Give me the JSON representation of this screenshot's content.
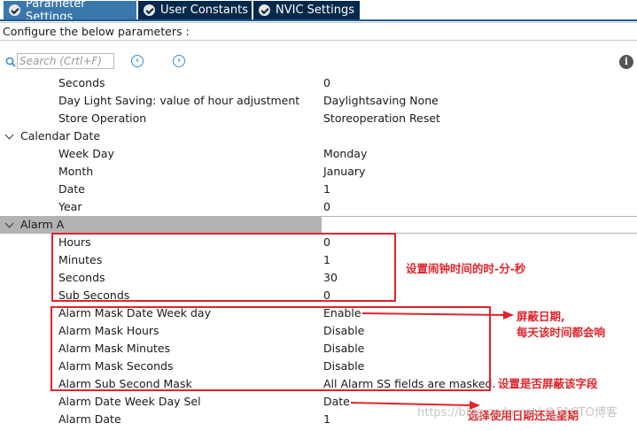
{
  "tabs": [
    {
      "label": "Parameter Settings",
      "active": true
    },
    {
      "label": "User Constants",
      "active": false
    },
    {
      "label": "NVIC Settings",
      "active": false
    }
  ],
  "configure_label": "Configure the below parameters :",
  "search": {
    "placeholder": "Search (Crtl+F)"
  },
  "rows": [
    {
      "name": "Seconds",
      "value": "0"
    },
    {
      "name": "Day Light Saving: value of hour adjustment",
      "value": "Daylightsaving None"
    },
    {
      "name": "Store Operation",
      "value": "Storeoperation Reset"
    },
    {
      "group": "Calendar Date"
    },
    {
      "name": "Week Day",
      "value": "Monday"
    },
    {
      "name": "Month",
      "value": "January"
    },
    {
      "name": "Date",
      "value": "1"
    },
    {
      "name": "Year",
      "value": "0"
    },
    {
      "group": "Alarm A"
    },
    {
      "name": "Hours",
      "value": "0"
    },
    {
      "name": "Minutes",
      "value": "1"
    },
    {
      "name": "Seconds",
      "value": "30"
    },
    {
      "name": "Sub Seconds",
      "value": "0"
    },
    {
      "name": "Alarm Mask Date Week day",
      "value": "Enable"
    },
    {
      "name": "Alarm Mask Hours",
      "value": "Disable"
    },
    {
      "name": "Alarm Mask Minutes",
      "value": "Disable"
    },
    {
      "name": "Alarm Mask Seconds",
      "value": "Disable"
    },
    {
      "name": "Alarm Sub Second Mask",
      "value": "All Alarm SS fields are masked."
    },
    {
      "name": "Alarm Date Week Day Sel",
      "value": "Date"
    },
    {
      "name": "Alarm Date",
      "value": "1"
    }
  ],
  "annotations": {
    "time": "设置闹钟时间的时-分-秒",
    "mask_line1": "屏蔽日期,",
    "mask_line2": "每天该时间都会响",
    "mask_field": "设置是否屏蔽该字段",
    "date_sel": "选择使用日期还是星期"
  },
  "watermark": "https://blog.csdn.net/  @51CTO博客",
  "colors": {
    "tab_bg": "#05294a",
    "tab_active": "#3a78ac",
    "annotation": "#e0242a",
    "selected_row": "#b3b3b3"
  }
}
